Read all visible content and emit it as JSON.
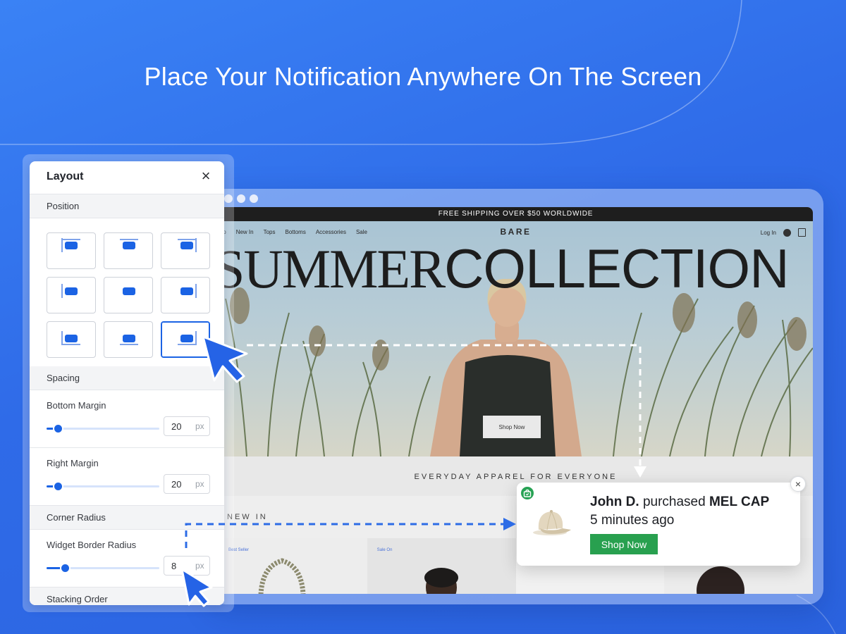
{
  "headline": "Place Your Notification Anywhere On The Screen",
  "panel": {
    "title": "Layout",
    "close_icon": "close-icon",
    "sections": {
      "position": "Position",
      "spacing": "Spacing",
      "corner_radius": "Corner Radius",
      "stacking_order": "Stacking Order"
    },
    "positions": [
      "top-left",
      "top-center",
      "top-right",
      "middle-left",
      "center",
      "middle-right",
      "bottom-left",
      "bottom-center",
      "bottom-right"
    ],
    "selected_position": "bottom-right",
    "bottom_margin": {
      "label": "Bottom Margin",
      "value": "20",
      "unit": "px",
      "slider_fraction": 0.1
    },
    "right_margin": {
      "label": "Right Margin",
      "value": "20",
      "unit": "px",
      "slider_fraction": 0.1
    },
    "border_radius": {
      "label": "Widget Border Radius",
      "value": "8",
      "unit": "px",
      "slider_fraction": 0.16
    }
  },
  "site": {
    "shipping_bar": "FREE SHIPPING OVER $50 WORLDWIDE",
    "nav": [
      "Shop",
      "New In",
      "Tops",
      "Bottoms",
      "Accessories",
      "Sale"
    ],
    "brand": "BARE",
    "login": "Log In",
    "cart_count": "0",
    "hero_title_serif": "SUMMER",
    "hero_title_sans": "COLLECTION",
    "hero_button": "Shop Now",
    "tagline": "EVERYDAY APPAREL FOR EVERYONE",
    "new_in": "NEW IN",
    "product_tags": [
      "Best Seller",
      "Sale On",
      "",
      ""
    ]
  },
  "notification": {
    "buyer": "John D.",
    "verb": "purchased",
    "product": "MEL CAP",
    "time": "5 minutes ago",
    "button": "Shop Now",
    "badge_icon": "shopping-bag-icon",
    "close_icon": "close-icon",
    "image_icon": "cap-icon"
  },
  "colors": {
    "accent": "#1b63e4",
    "notif_button": "#28a04f",
    "background": "#2f6be8"
  }
}
